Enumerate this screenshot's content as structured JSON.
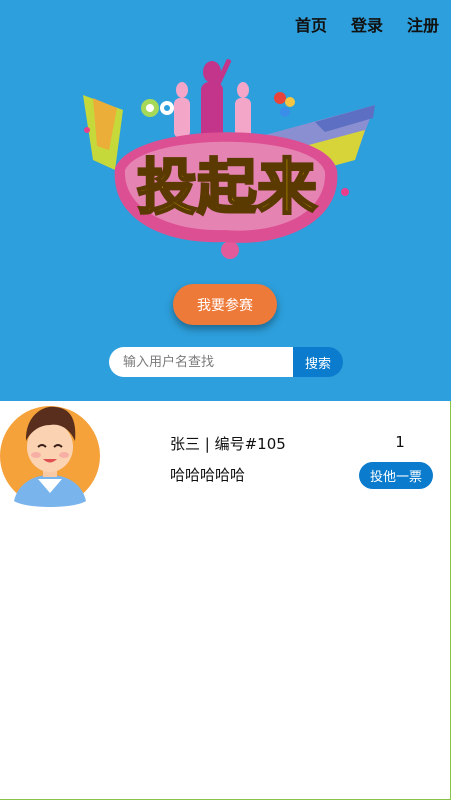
{
  "nav": {
    "items": [
      {
        "label": "首页"
      },
      {
        "label": "登录"
      },
      {
        "label": "注册"
      }
    ]
  },
  "hero": {
    "banner_text": "投起来",
    "join_label": "我要参赛",
    "search": {
      "placeholder": "输入用户名查找",
      "button_label": "搜索"
    }
  },
  "candidates": [
    {
      "name_line": "张三 | 编号#105",
      "description": "哈哈哈哈哈",
      "votes": "1",
      "vote_label": "投他一票"
    }
  ],
  "colors": {
    "hero_bg": "#2d9fdc",
    "join_btn": "#ee7a3a",
    "primary_btn": "#0b7ccd"
  }
}
